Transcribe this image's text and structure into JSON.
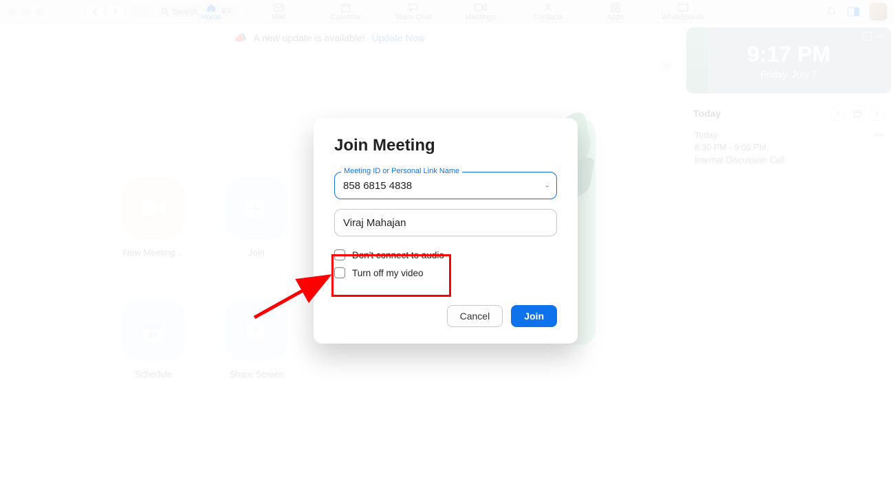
{
  "titlebar": {
    "search_placeholder": "Search",
    "shortcut": "⌘F",
    "nav": [
      {
        "label": "Home",
        "active": true
      },
      {
        "label": "Mail",
        "active": false
      },
      {
        "label": "Calendar",
        "active": false
      },
      {
        "label": "Team Chat",
        "active": false
      },
      {
        "label": "Meetings",
        "active": false
      },
      {
        "label": "Contacts",
        "active": false
      },
      {
        "label": "Apps",
        "active": false
      },
      {
        "label": "Whiteboards",
        "active": false
      }
    ]
  },
  "banner": {
    "text": "A new update is available!",
    "link": "Update Now"
  },
  "tiles": {
    "new_meeting": "New Meeting",
    "join": "Join",
    "schedule": "Schedule",
    "schedule_date": "19",
    "share_screen": "Share Screen"
  },
  "sidepanel": {
    "time": "9:17 PM",
    "date": "Friday, July 7",
    "today_label": "Today",
    "event": {
      "day": "Today",
      "time": "8:30 PM - 9:00 PM",
      "title": "Internal Discussion Call"
    }
  },
  "modal": {
    "title": "Join Meeting",
    "meeting_id_label": "Meeting ID or Personal Link Name",
    "meeting_id_value": "858 6815 4838",
    "name_value": "Viraj Mahajan",
    "check_audio": "Don't connect to audio",
    "check_video": "Turn off my video",
    "cancel": "Cancel",
    "join": "Join"
  }
}
